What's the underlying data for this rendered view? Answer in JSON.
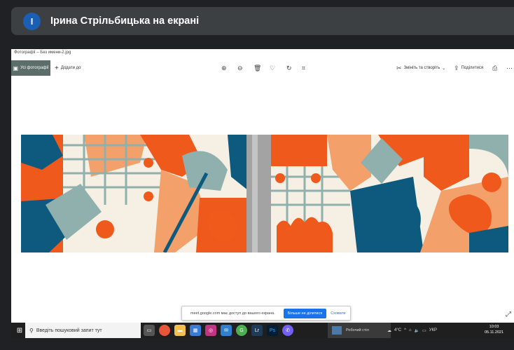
{
  "banner": {
    "avatar_letter": "І",
    "title": "Ірина Стрільбицька на екрані"
  },
  "viewer": {
    "window_title": "Фотографії – Без имени-2.jpg",
    "all_photos_label": "Усі фотографії",
    "add_to_label": "Додати до",
    "edit_create_label": "Змініть та створіть",
    "share_label": "Поділитися",
    "icons": [
      "zoom-in-icon",
      "zoom-out-icon",
      "delete-icon",
      "favorite-icon",
      "rotate-icon",
      "crop-icon",
      "print-icon",
      "more-icon"
    ]
  },
  "share_bar": {
    "message": "meet.google.com має доступ до вашого екрана.",
    "stop_label": "Більше не ділитися",
    "hide_label": "Сховати"
  },
  "taskbar": {
    "search_placeholder": "Введіть пошуковий запит тут",
    "desktop_label": "Робочий стіл",
    "temperature": "4°C",
    "language": "УКР",
    "time": "10:03",
    "date": "05.11.2021"
  },
  "colors": {
    "orange": "#f0591c",
    "peach": "#f4a06a",
    "navy": "#0e5a7e",
    "sage": "#8fb0ad",
    "cream": "#f5efe4"
  }
}
